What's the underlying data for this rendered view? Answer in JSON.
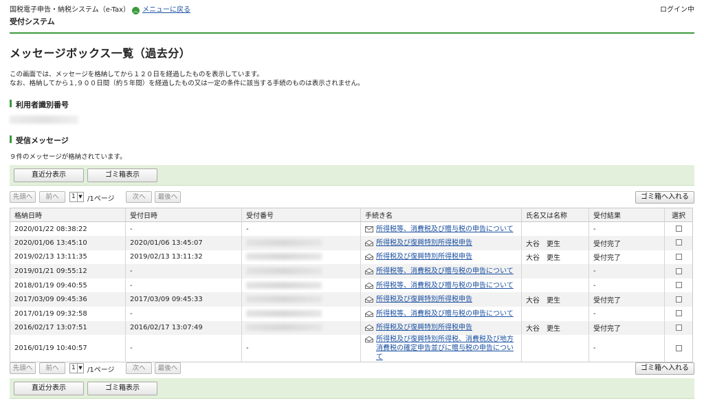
{
  "header": {
    "system_name": "国税電子申告・納税システム（e-Tax）",
    "back_link": "メニューに戻る",
    "login_status": "ログイン中",
    "subsystem": "受付システム"
  },
  "page": {
    "title": "メッセージボックス一覧（過去分）",
    "desc_line1": "この画面では、メッセージを格納してから１２０日を経過したものを表示しています。",
    "desc_line2": "なお、格納してから１,９００日間（約５年間）を経過したもの又は一定の条件に該当する手続のものは表示されません。"
  },
  "sections": {
    "user_id_heading": "利用者識別番号",
    "received_heading": "受信メッセージ",
    "count_text": "９件のメッセージが格納されています。"
  },
  "buttons": {
    "recent": "直近分表示",
    "trash_view": "ゴミ箱表示",
    "move_to_trash": "ゴミ箱へ入れる"
  },
  "pager": {
    "first": "先頭へ",
    "prev": "前へ",
    "page_value": "1",
    "page_suffix": "/1ページ",
    "next": "次へ",
    "last": "最後へ"
  },
  "table": {
    "columns": [
      "格納日時",
      "受付日時",
      "受付番号",
      "手続き名",
      "氏名又は名称",
      "受付結果",
      "選択"
    ],
    "rows": [
      {
        "stored": "2020/01/22 08:38:22",
        "received": "-",
        "number": "-",
        "icon": "closed-envelope-icon",
        "proc": "所得税等、消費税及び贈与税の申告について",
        "name": "",
        "result": "-"
      },
      {
        "stored": "2020/01/06 13:45:10",
        "received": "2020/01/06 13:45:07",
        "number": "",
        "icon": "open-envelope-icon",
        "proc": "所得税及び復興特別所得税申告",
        "name": "大谷　更生",
        "result": "受付完了"
      },
      {
        "stored": "2019/02/13 13:11:35",
        "received": "2019/02/13 13:11:32",
        "number": "",
        "icon": "open-envelope-icon",
        "proc": "所得税及び復興特別所得税申告",
        "name": "大谷　更生",
        "result": "受付完了"
      },
      {
        "stored": "2019/01/21 09:55:12",
        "received": "-",
        "number": "",
        "icon": "open-envelope-icon",
        "proc": "所得税等、消費税及び贈与税の申告について",
        "name": "",
        "result": "-"
      },
      {
        "stored": "2018/01/19 09:40:55",
        "received": "-",
        "number": "",
        "icon": "open-envelope-icon",
        "proc": "所得税等、消費税及び贈与税の申告について",
        "name": "",
        "result": "-"
      },
      {
        "stored": "2017/03/09 09:45:36",
        "received": "2017/03/09 09:45:33",
        "number": "",
        "icon": "open-envelope-icon",
        "proc": "所得税及び復興特別所得税申告",
        "name": "大谷　更生",
        "result": "受付完了"
      },
      {
        "stored": "2017/01/19 09:32:58",
        "received": "-",
        "number": "",
        "icon": "open-envelope-icon",
        "proc": "所得税等、消費税及び贈与税の申告について",
        "name": "",
        "result": "-"
      },
      {
        "stored": "2016/02/17 13:07:51",
        "received": "2016/02/17 13:07:49",
        "number": "",
        "icon": "open-envelope-icon",
        "proc": "所得税及び復興特別所得税申告",
        "name": "大谷　更生",
        "result": "受付完了"
      },
      {
        "stored": "2016/01/19 10:40:57",
        "received": "-",
        "number": "-",
        "icon": "open-envelope-icon",
        "proc": "所得税及び復興特別所得税、消費税及び地方消費税の確定申告並びに贈与税の申告について",
        "name": "",
        "result": "-"
      }
    ]
  },
  "colors": {
    "accent_green": "#3a9a3a",
    "panel_green": "#e3f0db",
    "link_blue": "#1a4fa0"
  }
}
